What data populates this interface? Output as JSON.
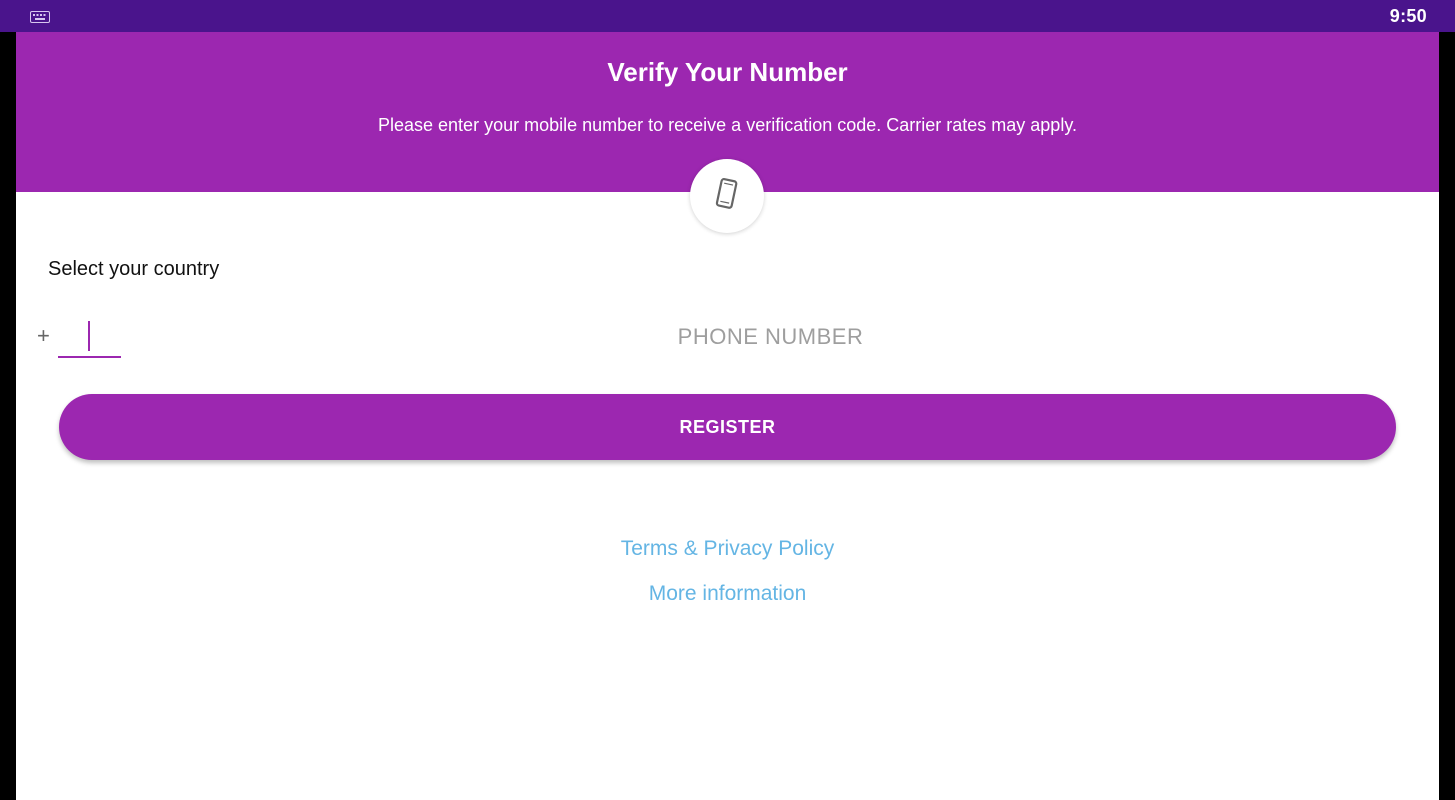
{
  "status_bar": {
    "keyboard_icon": "keyboard-icon",
    "time": "9:50"
  },
  "header": {
    "title": "Verify Your Number",
    "subtitle": "Please enter your mobile number to receive a verification code. Carrier rates may apply.",
    "icon": "smartphone-icon"
  },
  "form": {
    "country_label": "Select your country",
    "plus": "+",
    "country_code": "",
    "phone_placeholder": "PHONE NUMBER",
    "register_label": "REGISTER"
  },
  "links": {
    "terms": "Terms & Privacy Policy",
    "more_info": "More information"
  },
  "colors": {
    "status_bar": "#4a148c",
    "primary": "#9c27b0",
    "link": "#64b5e4",
    "placeholder": "#9e9e9e"
  }
}
